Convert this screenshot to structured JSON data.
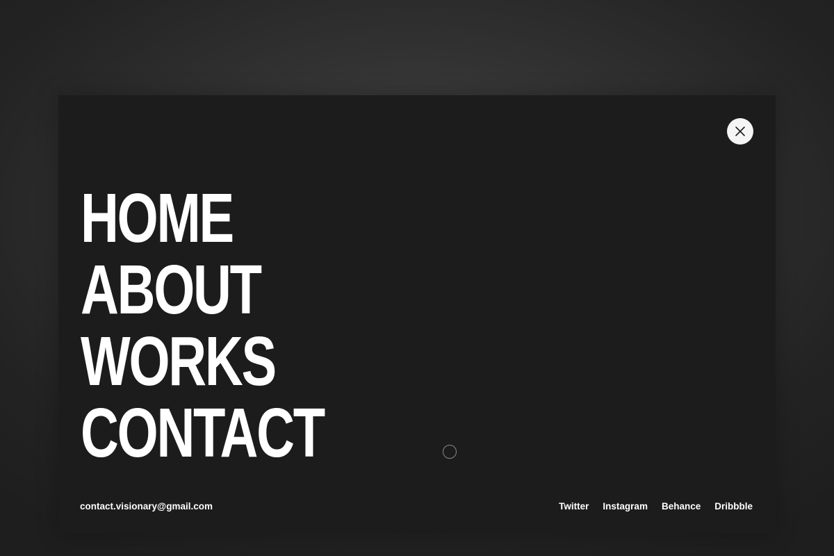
{
  "menu": {
    "items": [
      {
        "label": "HOME"
      },
      {
        "label": "ABOUT"
      },
      {
        "label": "WORKS"
      },
      {
        "label": "CONTACT"
      }
    ]
  },
  "footer": {
    "email": "contact.visionary@gmail.com",
    "socials": [
      {
        "label": "Twitter"
      },
      {
        "label": "Instagram"
      },
      {
        "label": "Behance"
      },
      {
        "label": "Dribbble"
      }
    ]
  },
  "icons": {
    "close": "close-icon"
  },
  "colors": {
    "panel_background": "#1c1c1c",
    "text": "#ffffff",
    "close_button_background": "#f5f5f5"
  }
}
